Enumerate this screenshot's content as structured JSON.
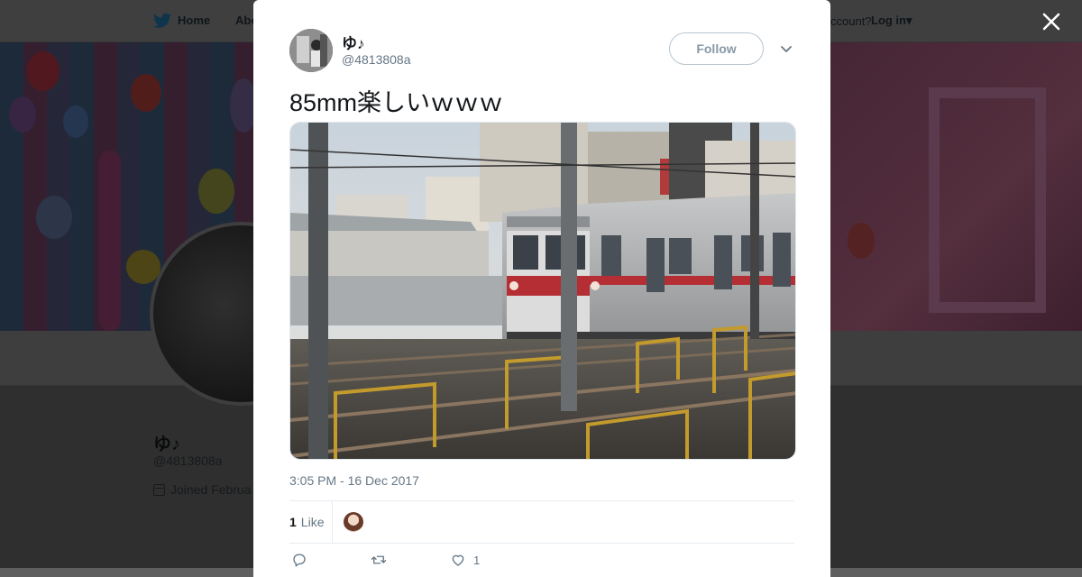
{
  "background": {
    "nav": {
      "home_label": "Home",
      "about_label": "Abo",
      "account_text": "ccount?",
      "login_label": "Log in"
    },
    "profile": {
      "name": "ゆ♪",
      "handle": "@4813808a",
      "joined": "Joined Februa"
    }
  },
  "tweet": {
    "author_name": "ゆ♪",
    "author_handle": "@4813808a",
    "follow_label": "Follow",
    "text": "85mm楽しいｗｗｗ",
    "timestamp": "3:05 PM - 16 Dec 2017",
    "like_count": "1",
    "like_label": "Like",
    "actions": {
      "reply_count": "",
      "retweet_count": "",
      "like_count": "1"
    }
  },
  "colors": {
    "twitter_blue": "#1da1f2",
    "text_primary": "#14171a",
    "text_secondary": "#657786",
    "divider": "#e6ecf0"
  },
  "icons": {
    "twitter_bird": "bird-icon",
    "close": "close-icon",
    "caret": "chevron-down-icon",
    "reply": "reply-icon",
    "retweet": "retweet-icon",
    "like": "heart-icon",
    "calendar": "calendar-icon"
  }
}
